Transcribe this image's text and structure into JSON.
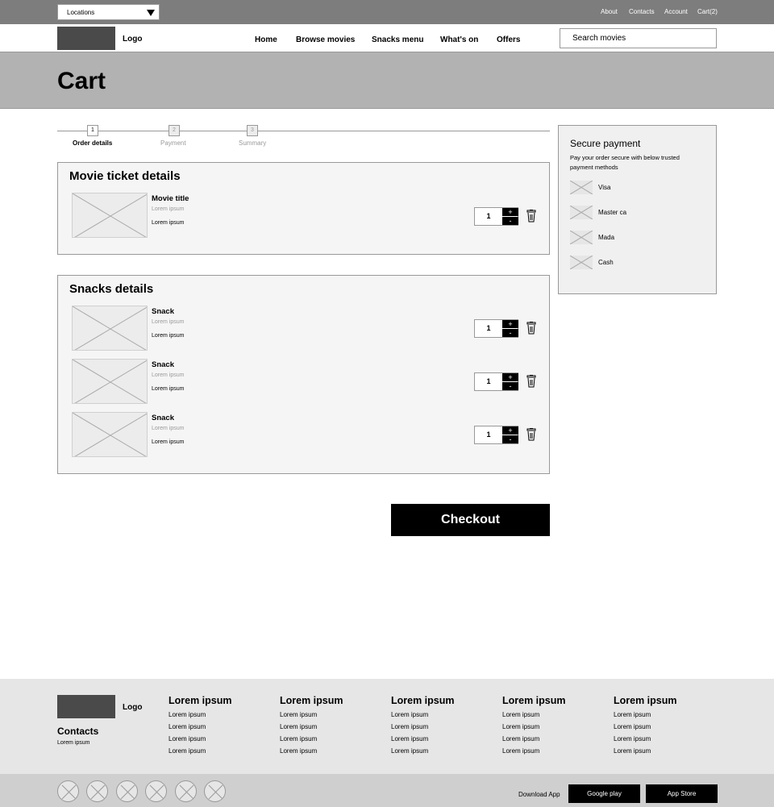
{
  "topbar": {
    "location_select": "Locations",
    "links": [
      "About",
      "Contacts",
      "Account",
      "Cart(2)"
    ]
  },
  "header": {
    "logo": "Logo",
    "nav": [
      "Home",
      "Browse movies",
      "Snacks menu",
      "What's on",
      "Offers"
    ],
    "search_placeholder": "Search movies"
  },
  "banner": {
    "title": "Cart"
  },
  "steps": [
    {
      "number": "1",
      "label": "Order details",
      "active": true
    },
    {
      "number": "2",
      "label": "Payment",
      "active": false
    },
    {
      "number": "3",
      "label": "Summary",
      "active": false
    }
  ],
  "movie_section": {
    "title": "Movie ticket details",
    "item": {
      "title": "Movie title",
      "sub": "Lorem ipsum",
      "detail": "Lorem ipsum",
      "qty": "1",
      "plus": "+",
      "minus": "-"
    }
  },
  "snacks_section": {
    "title": "Snacks details",
    "items": [
      {
        "title": "Snack",
        "sub": "Lorem ipsum",
        "detail": "Lorem ipsum",
        "qty": "1",
        "plus": "+",
        "minus": "-"
      },
      {
        "title": "Snack",
        "sub": "Lorem ipsum",
        "detail": "Lorem ipsum",
        "qty": "1",
        "plus": "+",
        "minus": "-"
      },
      {
        "title": "Snack",
        "sub": "Lorem ipsum",
        "detail": "Lorem ipsum",
        "qty": "1",
        "plus": "+",
        "minus": "-"
      }
    ]
  },
  "secure_payment": {
    "title": "Secure payment",
    "description_line1": "Pay your order secure with below trusted",
    "description_line2": "payment methods",
    "methods": [
      "Visa",
      "Master ca",
      "Mada",
      "Cash"
    ]
  },
  "checkout_label": "Checkout",
  "footer": {
    "logo": "Logo",
    "contacts_title": "Contacts",
    "contacts_text": "Lorem ipsum",
    "columns": [
      {
        "title": "Lorem ipsum",
        "items": [
          "Lorem ipsum",
          "Lorem ipsum",
          "Lorem ipsum",
          "Lorem ipsum"
        ]
      },
      {
        "title": "Lorem ipsum",
        "items": [
          "Lorem ipsum",
          "Lorem ipsum",
          "Lorem ipsum",
          "Lorem ipsum"
        ]
      },
      {
        "title": "Lorem ipsum",
        "items": [
          "Lorem ipsum",
          "Lorem ipsum",
          "Lorem ipsum",
          "Lorem ipsum"
        ]
      },
      {
        "title": "Lorem ipsum",
        "items": [
          "Lorem ipsum",
          "Lorem ipsum",
          "Lorem ipsum",
          "Lorem ipsum"
        ]
      },
      {
        "title": "Lorem ipsum",
        "items": [
          "Lorem ipsum",
          "Lorem ipsum",
          "Lorem ipsum",
          "Lorem ipsum"
        ]
      }
    ]
  },
  "bottom_bar": {
    "download_label": "Download App",
    "google_play": "Google play",
    "app_store": "App Store"
  },
  "icons": {
    "trash": "trash-icon",
    "image_placeholder": "image-placeholder-icon",
    "social": "social-icon"
  },
  "colors": {
    "topbar": "#7d7d7d",
    "banner": "#b2b2b2",
    "panel": "#f5f5f5",
    "footer": "#e6e6e6",
    "bottombar": "#cfcfcf",
    "button": "#000000"
  }
}
